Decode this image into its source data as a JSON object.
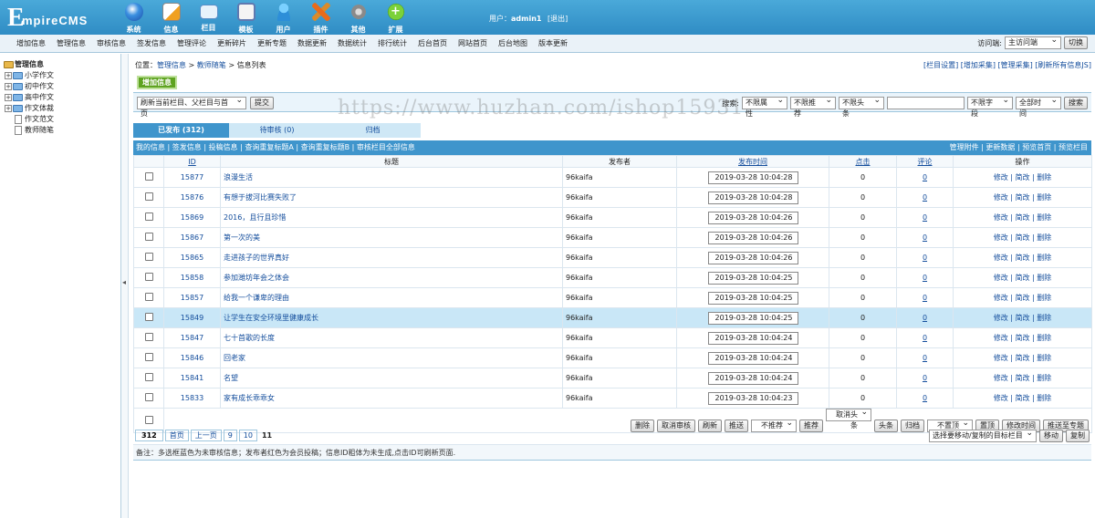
{
  "header": {
    "logo_text": "EmpireCMS",
    "nav": [
      {
        "label": "系统",
        "icon": "globe-icon"
      },
      {
        "label": "信息",
        "icon": "document-pen-icon"
      },
      {
        "label": "栏目",
        "icon": "folder-icon"
      },
      {
        "label": "模板",
        "icon": "template-icon"
      },
      {
        "label": "用户",
        "icon": "user-icon"
      },
      {
        "label": "插件",
        "icon": "tools-icon"
      },
      {
        "label": "其他",
        "icon": "gear-icon"
      },
      {
        "label": "扩展",
        "icon": "plus-circle-icon"
      }
    ],
    "user_prefix": "用户：",
    "username": "admin1",
    "logout": "[退出]"
  },
  "submenu": {
    "items": [
      "增加信息",
      "管理信息",
      "审核信息",
      "签发信息",
      "管理评论",
      "更新碎片",
      "更新专题",
      "数据更新",
      "数据统计",
      "排行统计",
      "后台首页",
      "网站首页",
      "后台地图",
      "版本更新"
    ],
    "visit_label": "访问端:",
    "visit_value": "主访问端",
    "switch": "切换"
  },
  "tree": {
    "root": "管理信息",
    "items": [
      {
        "label": "小学作文",
        "type": "folder"
      },
      {
        "label": "初中作文",
        "type": "folder"
      },
      {
        "label": "高中作文",
        "type": "folder"
      },
      {
        "label": "作文体裁",
        "type": "folder"
      },
      {
        "label": "作文范文",
        "type": "page"
      },
      {
        "label": "教师随笔",
        "type": "page"
      }
    ]
  },
  "main": {
    "crumb_prefix": "位置：",
    "crumb": [
      "管理信息",
      "教师随笔",
      "信息列表"
    ],
    "crumb_sep": " > ",
    "crumb_right": "[栏目设置] [增加采集] [管理采集] [刷新所有信息JS]",
    "add_button": "增加信息",
    "refresh_select": "刷新当前栏目、父栏目与首页",
    "submit": "提交",
    "search_label": "搜索:",
    "filters": [
      "不限属性",
      "不限推荐",
      "不限头条"
    ],
    "field_select": "不限字段",
    "time_select": "全部时间",
    "search_button": "搜索",
    "tabs": [
      "已发布 (312)",
      "待审核 (0)",
      "归档"
    ],
    "toolbar_left": "我的信息 | 签发信息 | 投稿信息 | 查询重复标题A | 查询重复标题B | 审核栏目全部信息",
    "toolbar_right": "管理附件 | 更新数据 | 预览首页 | 预览栏目",
    "columns": {
      "id": "ID",
      "title": "标题",
      "publisher": "发布者",
      "time": "发布时间",
      "clicks": "点击",
      "comments": "评论",
      "ops": "操作"
    },
    "ops_text": "修改 | 简改 | 删除",
    "rows": [
      {
        "id": "15877",
        "title": "浪漫生活",
        "publisher": "96kaifa",
        "time": "2019-03-28 10:04:28",
        "clicks": "0",
        "comments": "0"
      },
      {
        "id": "15876",
        "title": "有想于拔河比赛失败了",
        "publisher": "96kaifa",
        "time": "2019-03-28 10:04:28",
        "clicks": "0",
        "comments": "0"
      },
      {
        "id": "15869",
        "title": "2016，且行且珍惜",
        "publisher": "96kaifa",
        "time": "2019-03-28 10:04:26",
        "clicks": "0",
        "comments": "0"
      },
      {
        "id": "15867",
        "title": "第一次的美",
        "publisher": "96kaifa",
        "time": "2019-03-28 10:04:26",
        "clicks": "0",
        "comments": "0"
      },
      {
        "id": "15865",
        "title": "走进孩子的世界真好",
        "publisher": "96kaifa",
        "time": "2019-03-28 10:04:26",
        "clicks": "0",
        "comments": "0"
      },
      {
        "id": "15858",
        "title": "参加潍坊年会之体会",
        "publisher": "96kaifa",
        "time": "2019-03-28 10:04:25",
        "clicks": "0",
        "comments": "0"
      },
      {
        "id": "15857",
        "title": "给我一个谦卑的理由",
        "publisher": "96kaifa",
        "time": "2019-03-28 10:04:25",
        "clicks": "0",
        "comments": "0"
      },
      {
        "id": "15849",
        "title": "让学生在安全环境里健康成长",
        "publisher": "96kaifa",
        "time": "2019-03-28 10:04:25",
        "clicks": "0",
        "comments": "0",
        "highlight": true
      },
      {
        "id": "15847",
        "title": "七十首歌的长度",
        "publisher": "96kaifa",
        "time": "2019-03-28 10:04:24",
        "clicks": "0",
        "comments": "0"
      },
      {
        "id": "15846",
        "title": "回老家",
        "publisher": "96kaifa",
        "time": "2019-03-28 10:04:24",
        "clicks": "0",
        "comments": "0"
      },
      {
        "id": "15841",
        "title": "名望",
        "publisher": "96kaifa",
        "time": "2019-03-28 10:04:24",
        "clicks": "0",
        "comments": "0"
      },
      {
        "id": "15833",
        "title": "家有成长乖乖女",
        "publisher": "96kaifa",
        "time": "2019-03-28 10:04:23",
        "clicks": "0",
        "comments": "0"
      }
    ],
    "bulk": [
      "删除",
      "取消审核",
      "刷新",
      "推送"
    ],
    "bulk_recommend_select": "不推荐",
    "bulk_recommend_btn": "推荐",
    "bulk_head_select": "取消头条",
    "bulk_head_btn": "头条",
    "bulk_archive": "归档",
    "bulk_top_select": "不置顶",
    "bulk_top_btn": "置顶",
    "bulk_time": "修改时间",
    "bulk_push_topic": "推送至专题",
    "pager": {
      "total": "312",
      "first": "首页",
      "prev": "上一页",
      "pages": [
        "9",
        "10"
      ],
      "current": "11"
    },
    "move_select": "选择要移动/复制的目标栏目",
    "move": "移动",
    "copy": "复制",
    "note": "备注：多选框蓝色为未审核信息；发布者红色为会员投稿；信息ID粗体为未生成,点击ID可刷新页面."
  },
  "watermark": "https://www.huzhan.com/ishop15931"
}
